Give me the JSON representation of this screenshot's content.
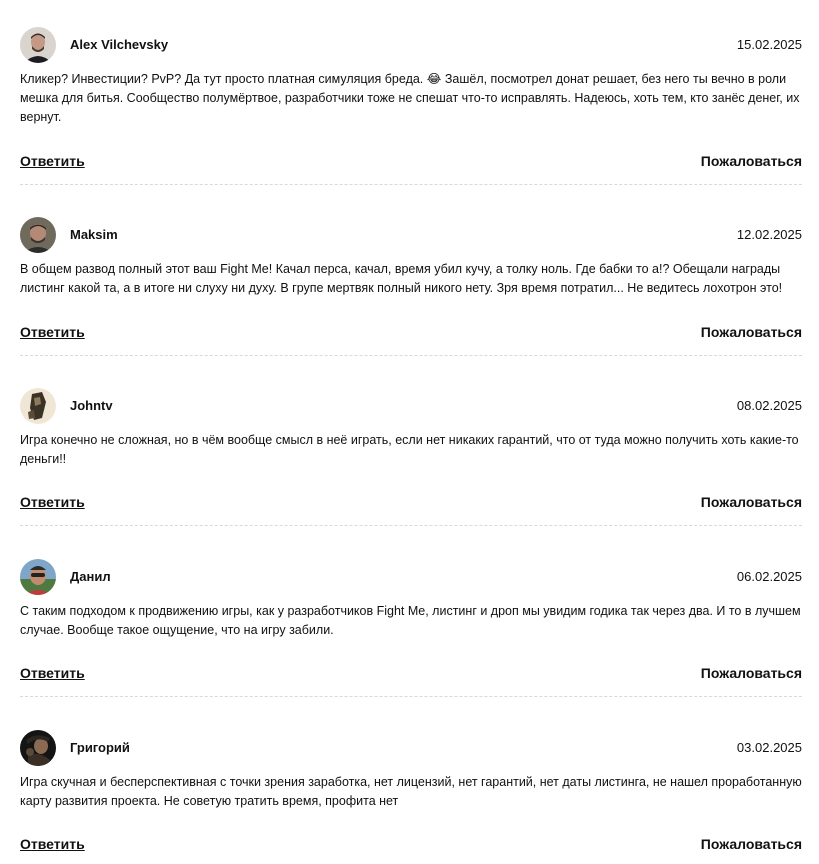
{
  "comments": [
    {
      "author": "Alex Vilchevsky",
      "date": "15.02.2025",
      "text": "Кликер? Инвестиции? PvP? Да тут просто платная симуляция бреда. 😂 Зашёл, посмотрел донат решает, без него ты вечно в роли мешка для битья. Сообщество полумёртвое, разработчики тоже не спешат что-то исправлять. Надеюсь, хоть тем, кто занёс денег, их вернут.",
      "reply_label": "Ответить",
      "report_label": "Пожаловаться",
      "avatar_icon": "user-avatar-photo"
    },
    {
      "author": "Maksim",
      "date": "12.02.2025",
      "text": "В общем развод полный этот ваш Fight Me! Качал перса, качал, время убил кучу, а толку ноль. Где бабки то а!? Обещали награды листинг какой та, а в итоге ни слуху ни духу. В групе мертвяк полный никого нету. Зря время потратил... Не ведитесь лохотрон это!",
      "reply_label": "Ответить",
      "report_label": "Пожаловаться",
      "avatar_icon": "user-avatar-photo"
    },
    {
      "author": "Johntv",
      "date": "08.02.2025",
      "text": "Игра конечно не сложная, но в чём вообще смысл в неё играть, если нет никаких гарантий, что от туда можно получить хоть какие-то деньги!!",
      "reply_label": "Ответить",
      "report_label": "Пожаловаться",
      "avatar_icon": "user-avatar-photo"
    },
    {
      "author": "Данил",
      "date": "06.02.2025",
      "text": "С таким подходом к продвижению игры, как у разработчиков Fight Me, листинг и дроп мы увидим годика так через два. И то в лучшем случае. Вообще такое ощущение, что на игру забили.",
      "reply_label": "Ответить",
      "report_label": "Пожаловаться",
      "avatar_icon": "user-avatar-photo"
    },
    {
      "author": "Григорий",
      "date": "03.02.2025",
      "text": "Игра скучная и бесперспективная с точки зрения заработка, нет лицензий, нет гарантий, нет даты листинга, не нашел проработанную карту развития проекта. Не советую тратить время, профита нет",
      "reply_label": "Ответить",
      "report_label": "Пожаловаться",
      "avatar_icon": "user-avatar-photo"
    }
  ]
}
